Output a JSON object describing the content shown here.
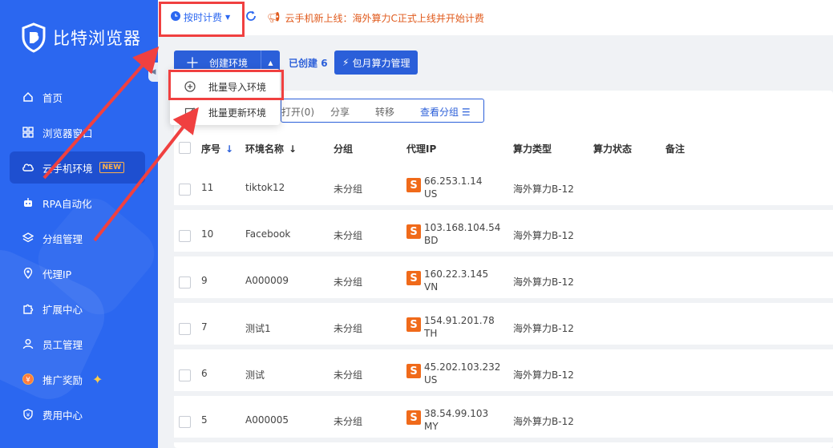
{
  "app": {
    "title": "比特浏览器"
  },
  "sidebar": {
    "items": [
      {
        "label": "首页",
        "icon": "home-icon"
      },
      {
        "label": "浏览器窗口",
        "icon": "grid-icon"
      },
      {
        "label": "云手机环境",
        "icon": "cloud-icon",
        "badge": "NEW",
        "active": true
      },
      {
        "label": "RPA自动化",
        "icon": "robot-icon"
      },
      {
        "label": "分组管理",
        "icon": "layers-icon"
      },
      {
        "label": "代理IP",
        "icon": "location-icon"
      },
      {
        "label": "扩展中心",
        "icon": "puzzle-icon"
      },
      {
        "label": "员工管理",
        "icon": "user-icon"
      },
      {
        "label": "推广奖励",
        "icon": "gift-icon"
      },
      {
        "label": "费用中心",
        "icon": "shield-yen-icon"
      }
    ]
  },
  "topbar": {
    "billing_label": "按时计费",
    "notice_label": "云手机新上线：",
    "notice_text": "海外算力C正式上线并开始计费"
  },
  "toolbar": {
    "create_label": "创建环境",
    "created_label": "已创建",
    "created_count": "6",
    "monthly_label": "包月算力管理"
  },
  "dropdown": {
    "items": [
      {
        "label": "批量导入环境",
        "icon": "plus-circle-icon"
      },
      {
        "label": "批量更新环境",
        "icon": "edit-icon"
      }
    ]
  },
  "filterbar": {
    "open": "打开(0)",
    "share": "分享",
    "move": "转移",
    "view_group": "查看分组"
  },
  "table": {
    "headers": {
      "seq": "序号",
      "name": "环境名称",
      "group": "分组",
      "proxy": "代理IP",
      "compute_type": "算力类型",
      "compute_status": "算力状态",
      "remark": "备注"
    },
    "rows": [
      {
        "seq": "11",
        "name": "tiktok12",
        "group": "未分组",
        "ip": "66.253.1.14",
        "country": "US",
        "compute": "海外算力B-12"
      },
      {
        "seq": "10",
        "name": "Facebook",
        "group": "未分组",
        "ip": "103.168.104.54",
        "country": "BD",
        "compute": "海外算力B-12"
      },
      {
        "seq": "9",
        "name": "A000009",
        "group": "未分组",
        "ip": "160.22.3.145",
        "country": "VN",
        "compute": "海外算力B-12"
      },
      {
        "seq": "7",
        "name": "测试1",
        "group": "未分组",
        "ip": "154.91.201.78",
        "country": "TH",
        "compute": "海外算力B-12"
      },
      {
        "seq": "6",
        "name": "测试",
        "group": "未分组",
        "ip": "45.202.103.232",
        "country": "US",
        "compute": "海外算力B-12"
      },
      {
        "seq": "5",
        "name": "A000005",
        "group": "未分组",
        "ip": "38.54.99.103",
        "country": "MY",
        "compute": "海外算力B-12"
      }
    ]
  },
  "proxy_badge": "S",
  "colors": {
    "primary": "#2b67f0",
    "button": "#2b5fd9",
    "notice": "#e05a1c",
    "annotation": "#f04040",
    "proxy_badge": "#f06a1a"
  }
}
